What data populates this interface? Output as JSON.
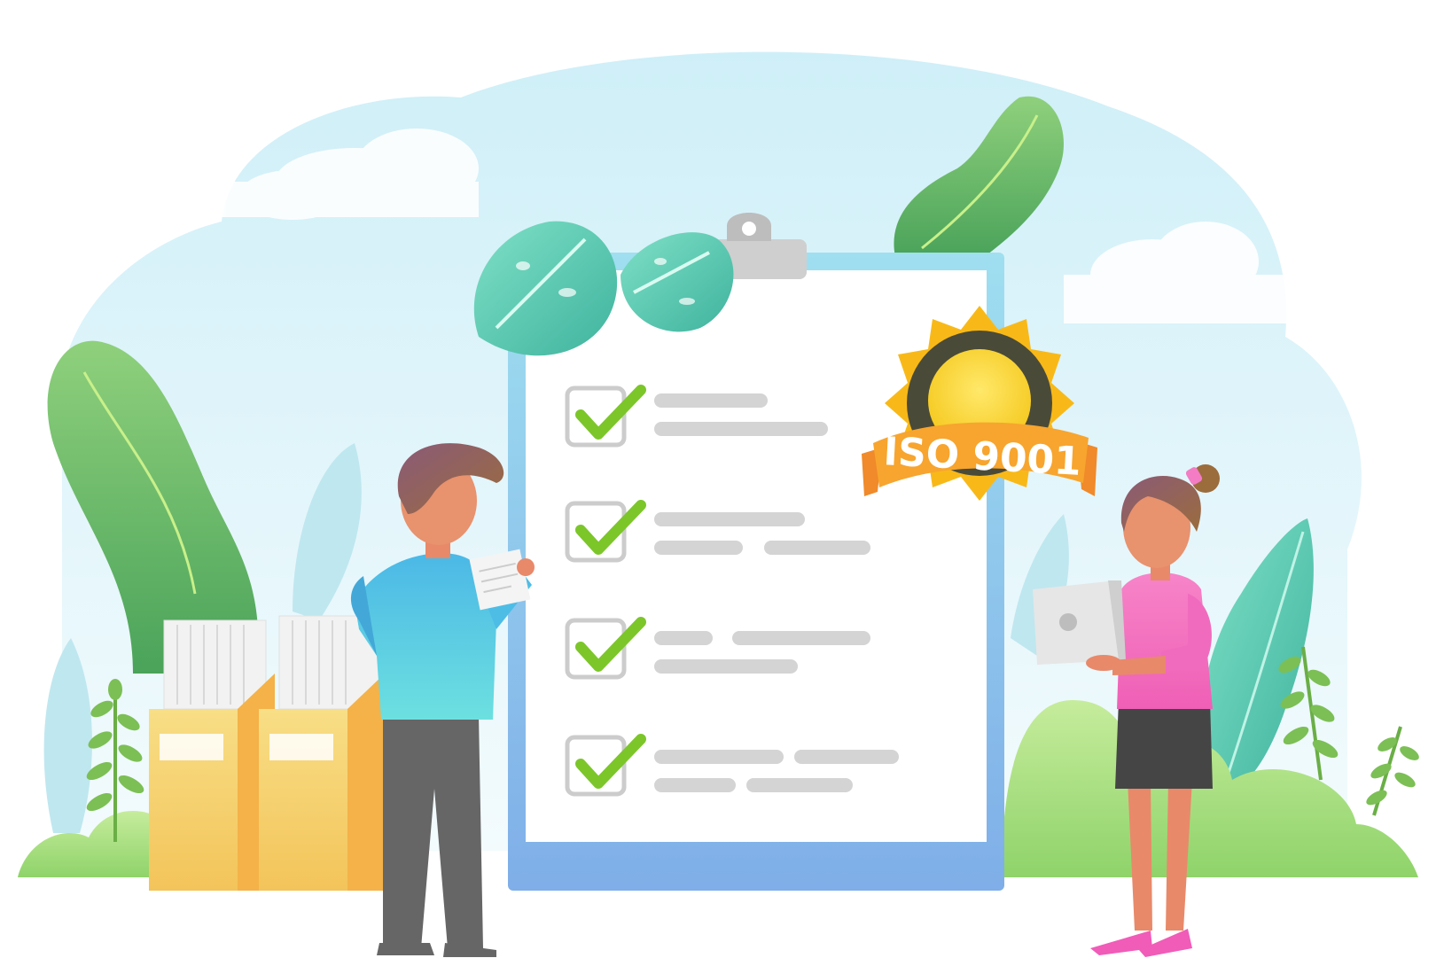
{
  "badge": {
    "label": "ISO 9001"
  },
  "checklist": {
    "items": [
      {
        "checked": true
      },
      {
        "checked": true
      },
      {
        "checked": true
      },
      {
        "checked": true
      }
    ]
  },
  "colors": {
    "sky": "#dff4fb",
    "clipboard_frame": "#86b6e6",
    "paper": "#ffffff",
    "check": "#7cc62a",
    "badge_gold": "#f7b81b",
    "ribbon": "#f29a2e",
    "folder_yellow": "#f6cf64",
    "plant_green": "#7cc46c",
    "man_shirt": "#5fd0e6",
    "woman_shirt": "#f46fc1"
  }
}
